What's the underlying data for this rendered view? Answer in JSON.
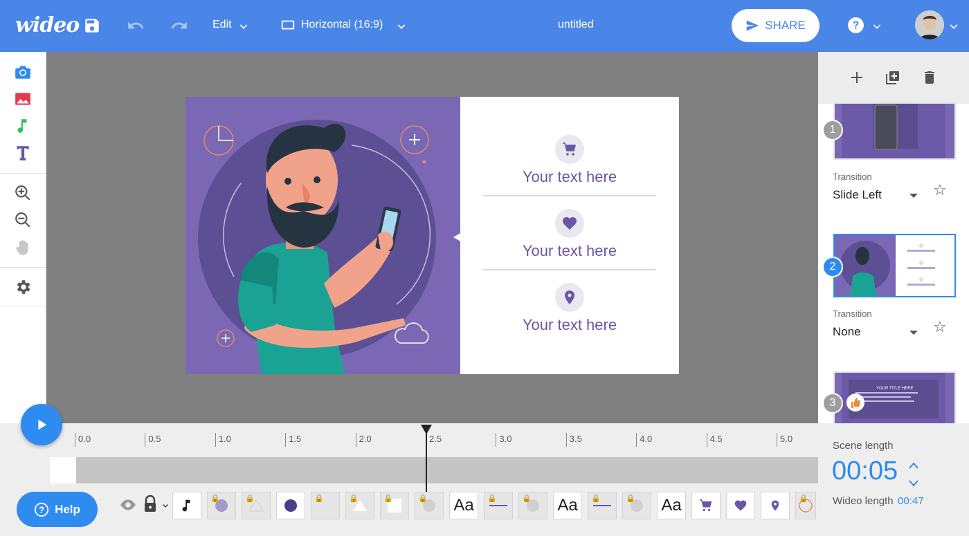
{
  "app": {
    "logo": "wideo",
    "title": "untitled"
  },
  "toolbar": {
    "edit_label": "Edit",
    "aspect_label": "Horizontal (16:9)",
    "share_label": "SHARE"
  },
  "scene": {
    "items": [
      {
        "icon": "cart-icon",
        "text": "Your text here"
      },
      {
        "icon": "heart-icon",
        "text": "Your text here"
      },
      {
        "icon": "location-pin-icon",
        "text": "Your text here"
      }
    ]
  },
  "scenes_panel": {
    "scenes": [
      {
        "number": "1",
        "transition_label": "Transition",
        "transition": "Slide Left"
      },
      {
        "number": "2",
        "transition_label": "Transition",
        "transition": "None"
      },
      {
        "number": "3",
        "thumb_title": "YOUR TITLE HERE"
      }
    ]
  },
  "timeline": {
    "ticks": [
      "0.0",
      "0.5",
      "1.0",
      "1.5",
      "2.0",
      "2.5",
      "3.0",
      "3.5",
      "4.0",
      "4.5",
      "5.0"
    ],
    "playhead_seconds": 2.5
  },
  "scene_length": {
    "label": "Scene length",
    "value": "00:05",
    "wideo_label": "Wideo length",
    "wideo_value": "00:47"
  },
  "help_label": "Help",
  "elements": [
    "music",
    "circle",
    "triangle-outline",
    "circle",
    "blank",
    "triangle",
    "square",
    "circle",
    "text",
    "line",
    "circle",
    "text",
    "line",
    "circle",
    "text",
    "cart",
    "heart",
    "pin",
    "circle"
  ],
  "element_text": "Aa",
  "colors": {
    "accent": "#4a86e8",
    "scene_purple": "#7b68b5",
    "text_purple": "#6a56a8",
    "play_blue": "#2e8bf0"
  }
}
